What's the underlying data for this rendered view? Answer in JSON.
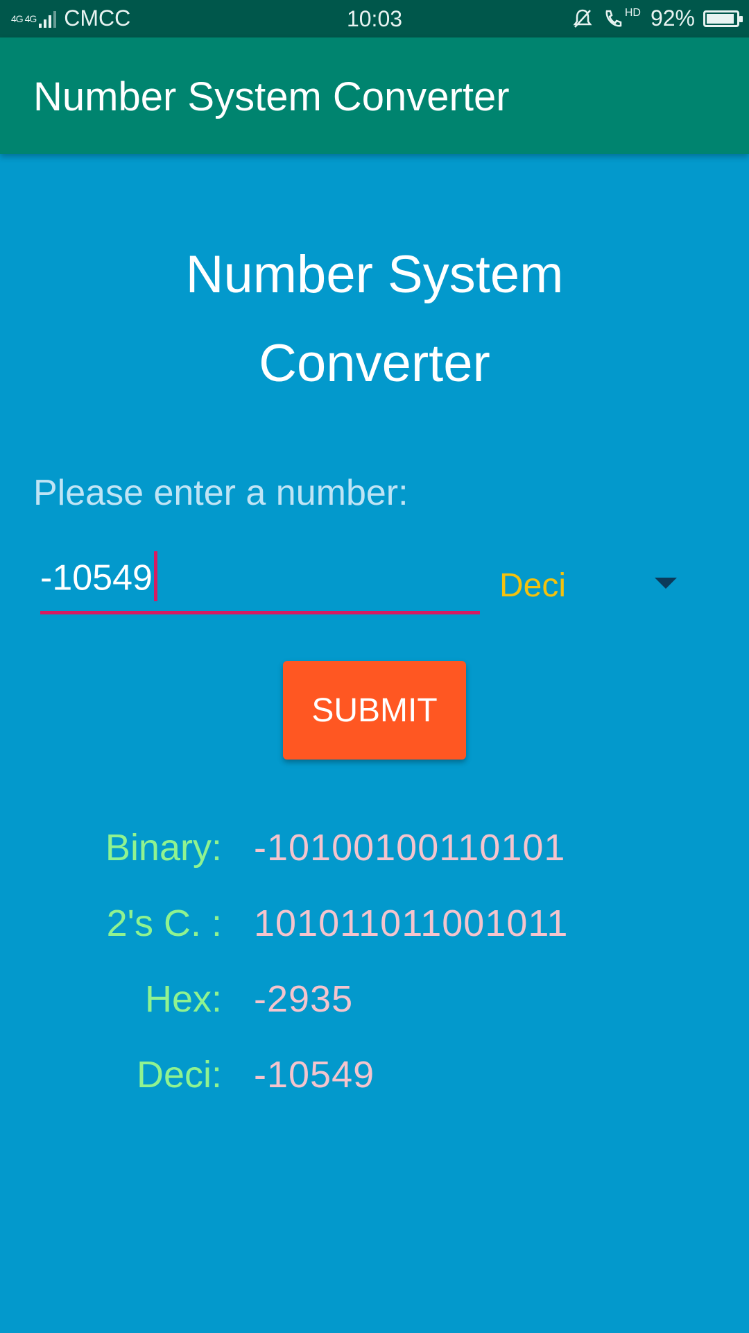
{
  "status_bar": {
    "network": "4G 4G",
    "carrier": "CMCC",
    "time": "10:03",
    "hd": "HD",
    "battery": "92%",
    "battery_level": 0.92
  },
  "app_bar": {
    "title": "Number System Converter"
  },
  "main": {
    "heading_line1": "Number System",
    "heading_line2": "Converter",
    "prompt": "Please enter a number:",
    "input_value": "-10549",
    "base_select": "Deci",
    "submit_label": "SUBMIT",
    "results": [
      {
        "label": "Binary:",
        "value": "-10100100110101"
      },
      {
        "label": "2's C. :",
        "value": "101011011001011"
      },
      {
        "label": "Hex:",
        "value": "-2935"
      },
      {
        "label": "Deci:",
        "value": "-10549"
      }
    ]
  },
  "colors": {
    "status_bar": "#00574b",
    "app_bar": "#00846f",
    "background": "#0399cc",
    "accent": "#d81b60",
    "button": "#ff5722",
    "select_text": "#f4c20d",
    "result_label": "#90f390",
    "result_value": "#f5c4cd"
  }
}
